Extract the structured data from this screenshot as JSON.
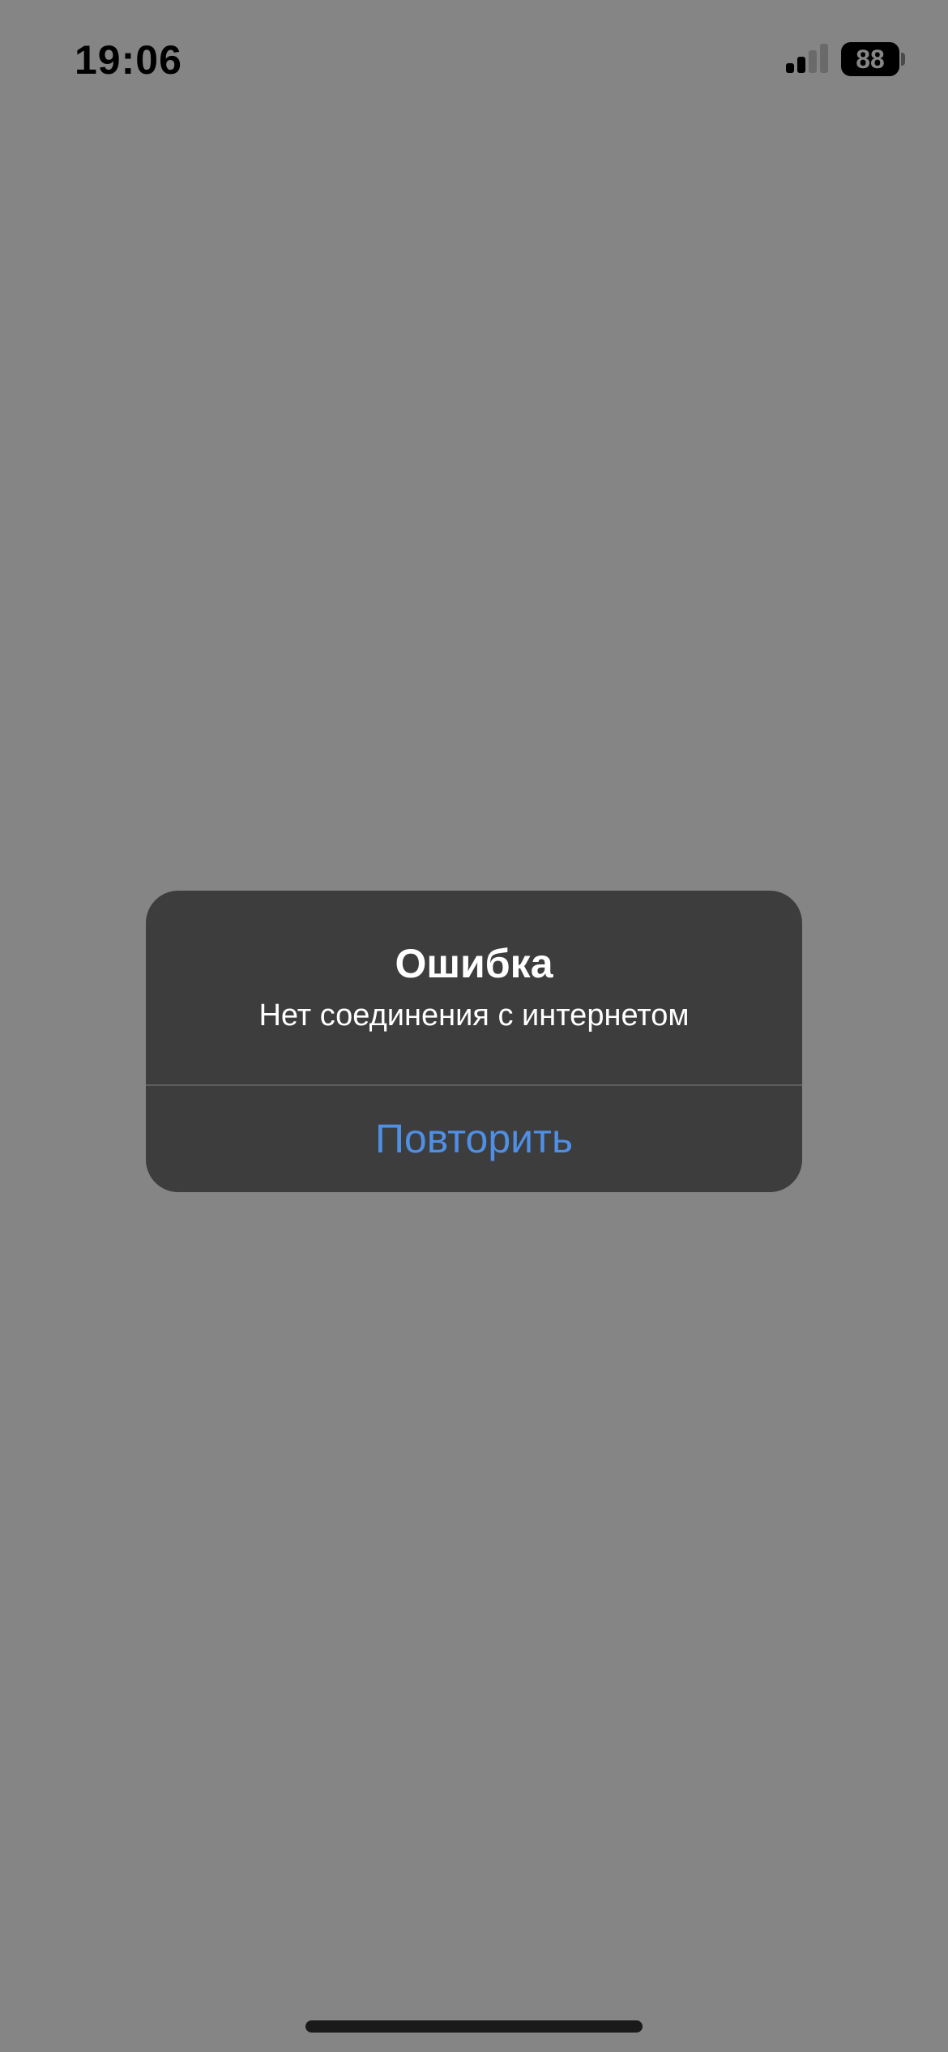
{
  "status_bar": {
    "time": "19:06",
    "battery_level": "88",
    "signal_strength": "2 of 4 bars",
    "signal_bars_active": 2,
    "signal_bars_total": 4
  },
  "alert": {
    "title": "Ошибка",
    "message": "Нет соединения с интернетом",
    "button_label": "Повторить"
  },
  "colors": {
    "background": "#858585",
    "alert_background": "#3d3d3d",
    "button_text": "#4f8fe5",
    "text_primary": "#ffffff"
  },
  "icons": {
    "signal": "cellular-signal-icon",
    "battery": "battery-icon"
  }
}
